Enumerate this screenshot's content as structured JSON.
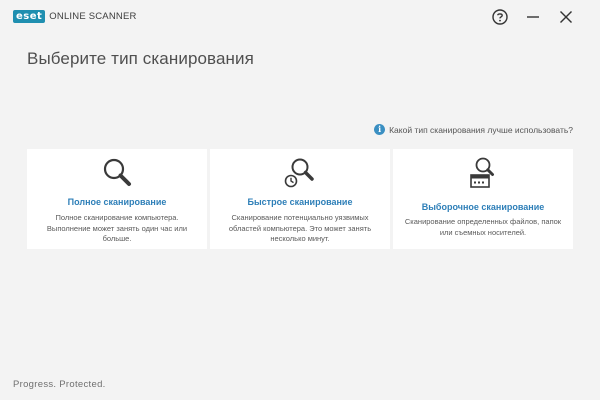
{
  "app": {
    "logo_badge": "eset",
    "logo_text": "ONLINE SCANNER"
  },
  "window_controls": {
    "help_icon": "help-circle-icon",
    "minimize_icon": "minimize-icon",
    "close_icon": "close-icon"
  },
  "main": {
    "title": "Выберите тип сканирования",
    "help_link": "Какой тип сканирования лучше использовать?",
    "cards": [
      {
        "icon": "magnifier-icon",
        "title": "Полное сканирование",
        "description": "Полное сканирование компьютера. Выполнение может занять один час или больше."
      },
      {
        "icon": "magnifier-clock-icon",
        "title": "Быстрое сканирование",
        "description": "Сканирование потенциально уязвимых областей компьютера. Это может занять несколько минут."
      },
      {
        "icon": "magnifier-window-icon",
        "title": "Выборочное сканирование",
        "description": "Сканирование определенных файлов, папок или съемных носителей."
      }
    ]
  },
  "footer": {
    "tagline": "Progress. Protected."
  },
  "colors": {
    "background": "#f3f3f3",
    "card_background": "#ffffff",
    "accent": "#2e7fb8",
    "logo_badge": "#1f8fb0"
  }
}
